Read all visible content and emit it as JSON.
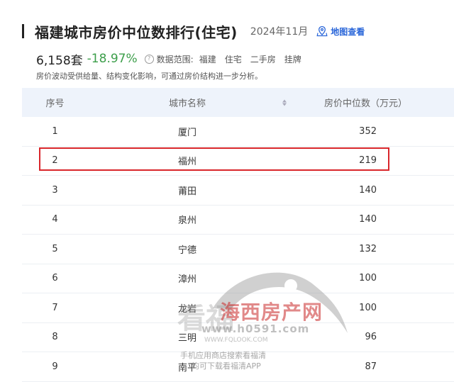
{
  "header": {
    "title": "福建城市房价中位数排行(住宅)",
    "date": "2024年11月",
    "map_link_label": "地图查看"
  },
  "stats": {
    "count": "6,158套",
    "change": "-18.97%",
    "scope_label": "数据范围:",
    "scope_tags": [
      "福建",
      "住宅",
      "二手房",
      "挂牌"
    ]
  },
  "note": "房价波动受供给量、结构变化影响，可通过房价结构进一步分析。",
  "table": {
    "columns": [
      "序号",
      "城市名称",
      "房价中位数（万元）"
    ],
    "rows": [
      {
        "rank": "1",
        "city": "厦门",
        "price": "352"
      },
      {
        "rank": "2",
        "city": "福州",
        "price": "219"
      },
      {
        "rank": "3",
        "city": "莆田",
        "price": "140"
      },
      {
        "rank": "4",
        "city": "泉州",
        "price": "140"
      },
      {
        "rank": "5",
        "city": "宁德",
        "price": "132"
      },
      {
        "rank": "6",
        "city": "漳州",
        "price": "100"
      },
      {
        "rank": "7",
        "city": "龙岩",
        "price": "100"
      },
      {
        "rank": "8",
        "city": "三明",
        "price": "96"
      },
      {
        "rank": "9",
        "city": "南平",
        "price": "87"
      }
    ]
  },
  "watermark": {
    "kan": "看福",
    "brand": "海西房产网",
    "domain": "www.h0591.com",
    "domain2": "WWW.FQLOOK.COM",
    "line1": "手机应用商店搜索看福清",
    "line2": "均可下载看福清APP"
  },
  "colors": {
    "accent_blue": "#2a66d9",
    "change_green": "#3c9e4a",
    "highlight_red": "#d9262b",
    "header_bg": "#eef3fb"
  }
}
